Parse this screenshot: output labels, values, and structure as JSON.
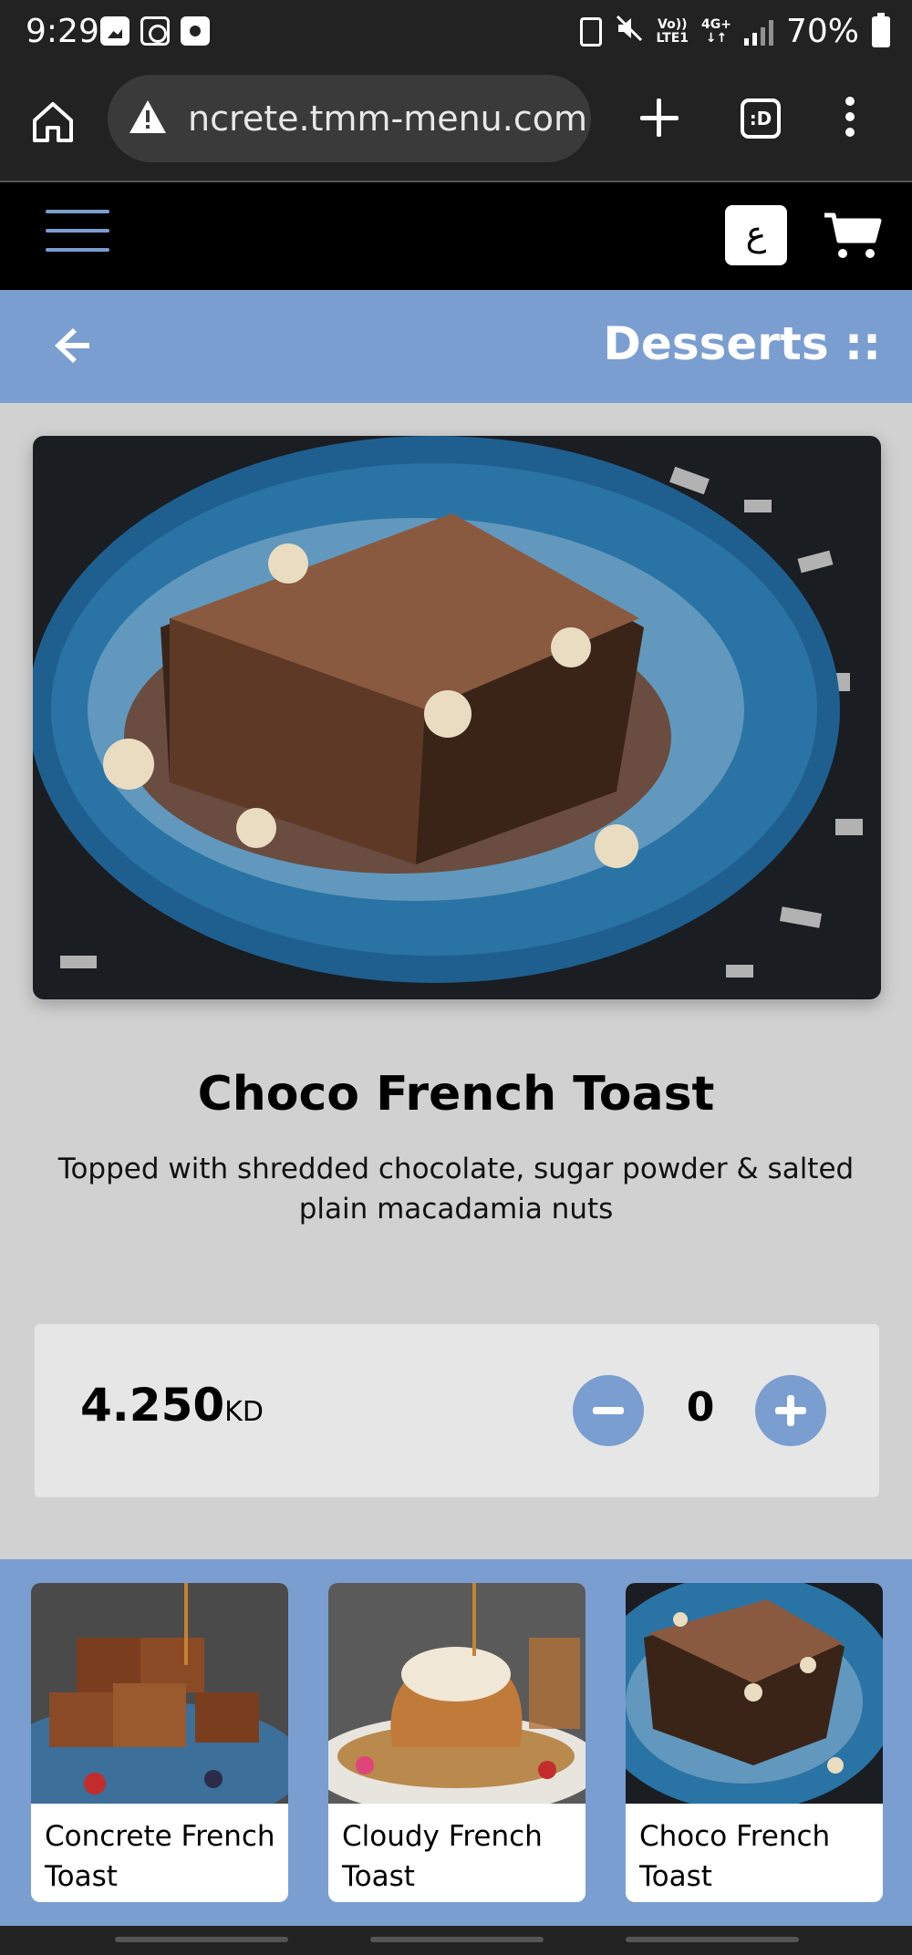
{
  "status_bar": {
    "time": "9:29",
    "network_top": "Vo))",
    "network_bottom": "LTE1",
    "data_top": "4G+",
    "battery_pct": "70%",
    "icons": [
      "gallery-icon",
      "instagram-icon",
      "clock-app-icon",
      "battery-saver-icon",
      "mute-icon",
      "signal-icon",
      "battery-icon"
    ]
  },
  "browser": {
    "url": "concrete.tmm-menu.com",
    "tabs_label": ":D",
    "icons": [
      "home-icon",
      "warning-icon",
      "plus-icon",
      "tabs-icon",
      "more-vert-icon"
    ]
  },
  "header": {
    "lang_label": "ع",
    "icons": [
      "hamburger-icon",
      "cart-icon"
    ]
  },
  "title_bar": {
    "title": "Desserts ::",
    "icons": [
      "back-arrow-icon"
    ]
  },
  "product": {
    "name": "Choco French Toast",
    "description": "Topped with shredded chocolate, sugar powder & salted plain macadamia nuts",
    "price": "4.250",
    "currency": "KD",
    "quantity": "0"
  },
  "related": {
    "items": [
      {
        "label": "Concrete French Toast"
      },
      {
        "label": "Cloudy French Toast"
      },
      {
        "label": "Choco French Toast"
      }
    ]
  },
  "colors": {
    "accent": "#7b9ed1",
    "header_bg": "#000000",
    "page_bg": "#d1d1d1",
    "panel_bg": "#e6e6e6",
    "chrome_bg": "#222222"
  }
}
